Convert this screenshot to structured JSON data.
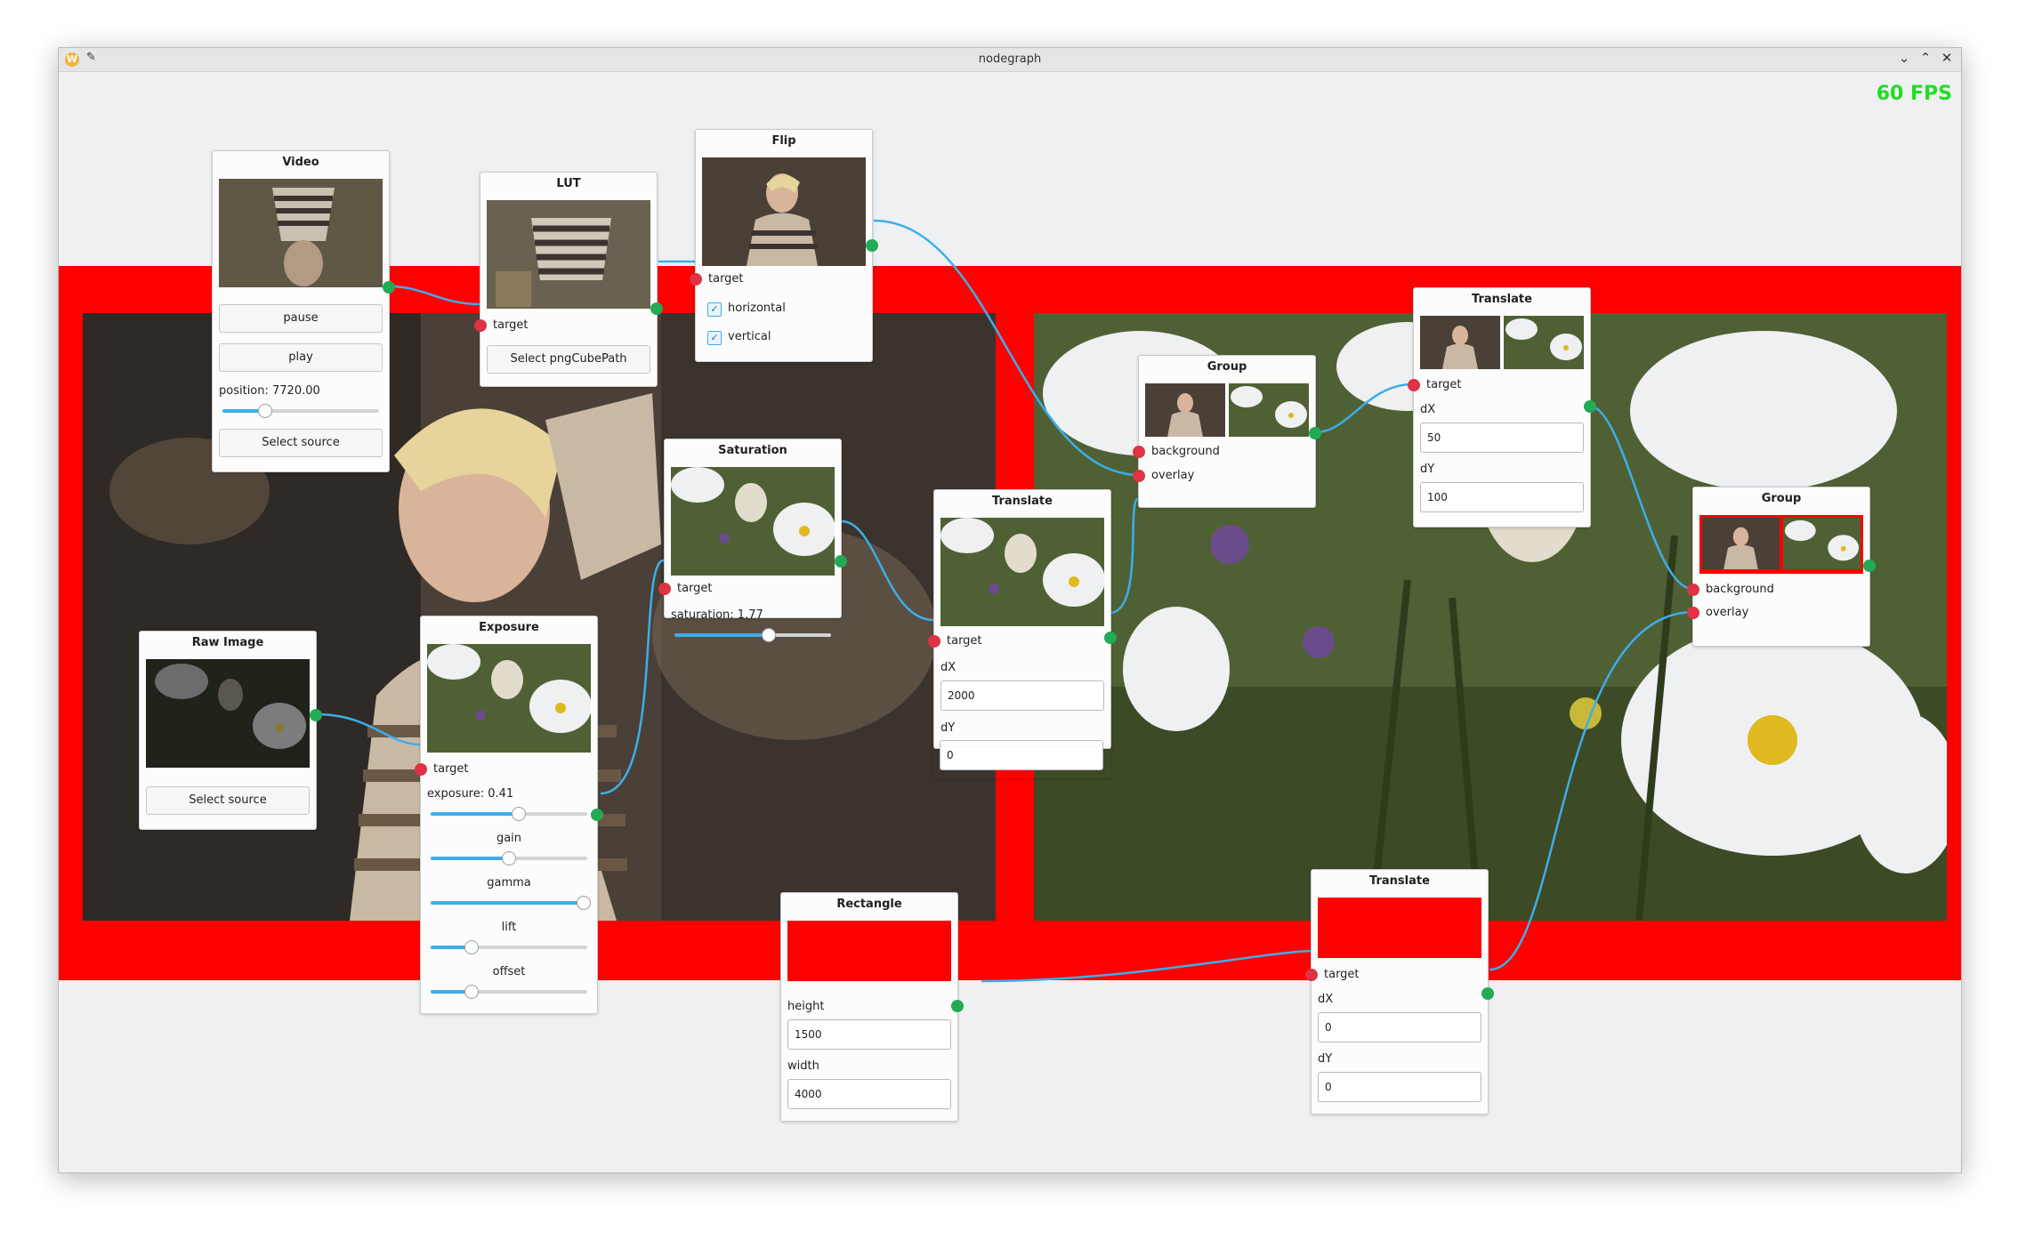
{
  "window": {
    "title": "nodegraph",
    "app_icon": "W"
  },
  "fps": "60 FPS",
  "nodes": {
    "video": {
      "title": "Video",
      "pause": "pause",
      "play": "play",
      "position_label": "position: 7720.00",
      "position": 0.27,
      "select": "Select source"
    },
    "lut": {
      "title": "LUT",
      "target": "target",
      "select": "Select pngCubePath"
    },
    "flip": {
      "title": "Flip",
      "target": "target",
      "horizontal": "horizontal",
      "vertical": "vertical",
      "horizontal_checked": true,
      "vertical_checked": true
    },
    "saturation": {
      "title": "Saturation",
      "target": "target",
      "saturation_label": "saturation: 1.77",
      "saturation": 0.6
    },
    "translate1": {
      "title": "Translate",
      "target": "target",
      "dx_label": "dX",
      "dx": "2000",
      "dy_label": "dY",
      "dy": "0"
    },
    "group1": {
      "title": "Group",
      "background": "background",
      "overlay": "overlay"
    },
    "translate2": {
      "title": "Translate",
      "target": "target",
      "dx_label": "dX",
      "dx": "50",
      "dy_label": "dY",
      "dy": "100"
    },
    "group2": {
      "title": "Group",
      "background": "background",
      "overlay": "overlay"
    },
    "raw": {
      "title": "Raw Image",
      "select": "Select source"
    },
    "exposure": {
      "title": "Exposure",
      "target": "target",
      "exposure_label": "exposure: 0.41",
      "exposure": 0.56,
      "gain_label": "gain",
      "gain": 0.5,
      "gamma_label": "gamma",
      "gamma": 0.98,
      "lift_label": "lift",
      "lift": 0.26,
      "offset_label": "offset",
      "offset": 0.26
    },
    "rectangle": {
      "title": "Rectangle",
      "height_label": "height",
      "height": "1500",
      "width_label": "width",
      "width": "4000"
    },
    "translate3": {
      "title": "Translate",
      "target": "target",
      "dx_label": "dX",
      "dx": "0",
      "dy_label": "dY",
      "dy": "0"
    }
  },
  "colors": {
    "accent": "#3daee9",
    "input_port": "#dd3344",
    "output_port": "#22aa55",
    "fps": "#22dd22",
    "red": "#ff0000"
  }
}
